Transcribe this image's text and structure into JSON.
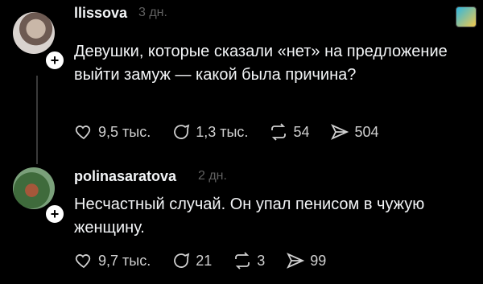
{
  "posts": [
    {
      "username": "llissova",
      "time": "3 дн.",
      "text": "Девушки, которые сказали «нет» на предложение выйти замуж — какой была причина?",
      "likes": "9,5 тыс.",
      "comments": "1,3 тыс.",
      "reposts": "54",
      "shares": "504"
    },
    {
      "username": "polinasaratova",
      "time": "2 дн.",
      "text": "Несчастный случай. Он упал пенисом в чужую женщину.",
      "likes": "9,7 тыс.",
      "comments": "21",
      "reposts": "3",
      "shares": "99"
    }
  ],
  "icons": [
    "heart-icon",
    "comment-icon",
    "repost-icon",
    "share-icon"
  ]
}
